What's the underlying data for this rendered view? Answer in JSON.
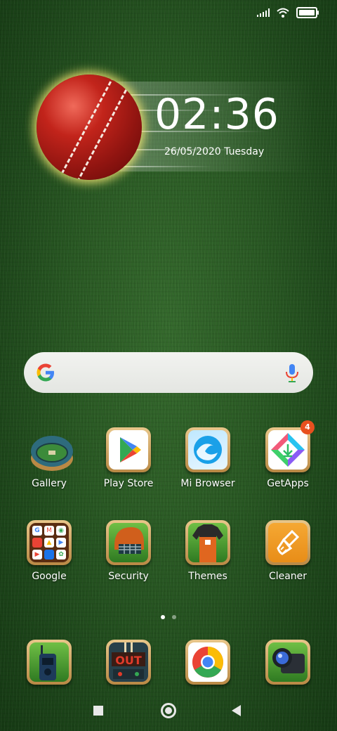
{
  "status_bar": {
    "icons": [
      "signal-icon",
      "wifi-icon",
      "battery-icon"
    ]
  },
  "clock_widget": {
    "time": "02:36",
    "date": "26/05/2020 Tuesday"
  },
  "search_bar": {
    "icons": [
      "google-g-icon",
      "mic-icon"
    ]
  },
  "apps": [
    {
      "label": "Gallery",
      "icon": "stadium-icon"
    },
    {
      "label": "Play Store",
      "icon": "play-store-icon"
    },
    {
      "label": "Mi Browser",
      "icon": "browser-wave-icon"
    },
    {
      "label": "GetApps",
      "icon": "getapps-icon",
      "badge": "4"
    },
    {
      "label": "Google",
      "icon": "google-folder-icon"
    },
    {
      "label": "Security",
      "icon": "cricket-helmet-icon"
    },
    {
      "label": "Themes",
      "icon": "cricket-jersey-icon"
    },
    {
      "label": "Cleaner",
      "icon": "brush-icon"
    }
  ],
  "dock": [
    {
      "icon": "walkie-talkie-icon"
    },
    {
      "icon": "out-scoreboard-icon"
    },
    {
      "icon": "chrome-icon"
    },
    {
      "icon": "camera-icon"
    }
  ],
  "page_indicator": {
    "pages": 2,
    "current": 1
  },
  "nav_bar": {
    "icons": [
      "recents-icon",
      "home-icon",
      "back-icon"
    ]
  },
  "colors": {
    "badge": "#e8501f",
    "grass": "#2a5a24",
    "tile_frame": "#c9a05a"
  }
}
